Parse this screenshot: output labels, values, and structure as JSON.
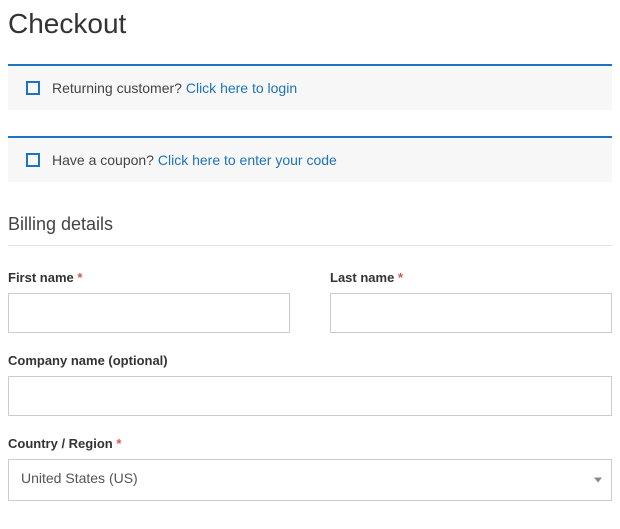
{
  "page": {
    "title": "Checkout"
  },
  "notices": {
    "login": {
      "text": "Returning customer? ",
      "link": "Click here to login"
    },
    "coupon": {
      "text": "Have a coupon? ",
      "link": "Click here to enter your code"
    }
  },
  "billing": {
    "section_title": "Billing details",
    "first_name": {
      "label": "First name",
      "required": "*"
    },
    "last_name": {
      "label": "Last name",
      "required": "*"
    },
    "company": {
      "label": "Company name (optional)"
    },
    "country": {
      "label": "Country / Region",
      "required": "*",
      "value": "United States (US)"
    }
  }
}
